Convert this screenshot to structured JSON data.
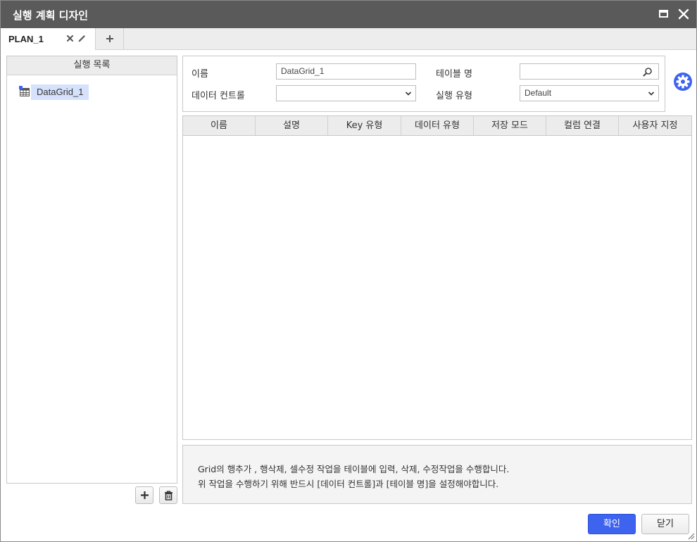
{
  "window": {
    "title": "실행 계획 디자인"
  },
  "tabs": [
    {
      "label": "PLAN_1"
    }
  ],
  "left_panel": {
    "header": "실행 목록",
    "items": [
      {
        "label": "DataGrid_1",
        "icon": "grid-table-icon",
        "selected": true
      }
    ]
  },
  "form": {
    "name_label": "이름",
    "name_value": "DataGrid_1",
    "table_name_label": "테이블 명",
    "table_name_value": "",
    "data_control_label": "데이터 컨트롤",
    "data_control_value": "",
    "exec_type_label": "실행 유형",
    "exec_type_value": "Default"
  },
  "grid": {
    "columns": [
      "이름",
      "설명",
      "Key 유형",
      "데이터 유형",
      "저장 모드",
      "컬럼 연결",
      "사용자 지정"
    ],
    "rows": []
  },
  "info": {
    "line1": "Grid의 행추가 , 행삭제, 셀수정 작업을 테이블에 입력, 삭제, 수정작업을 수행합니다.",
    "line2": "위 작업을 수행하기 위해 반드시 [데이터 컨트롤]과 [테이블 명]을 설정해야합니다."
  },
  "buttons": {
    "ok": "확인",
    "close": "닫기"
  },
  "colors": {
    "titlebar": "#5a5a5a",
    "accent": "#3e63ef",
    "selection": "#d6e2fb",
    "gear": "#3e63ef"
  }
}
